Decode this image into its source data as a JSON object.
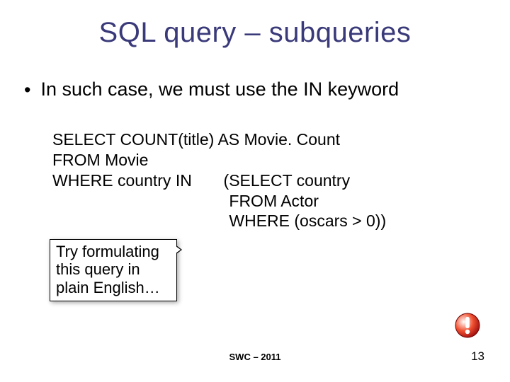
{
  "title": "SQL query – subqueries",
  "bullet": "In such case, we must use the IN keyword",
  "code": {
    "l1": "SELECT COUNT(title) AS Movie. Count",
    "l2": "FROM Movie",
    "l3": "WHERE country IN       (SELECT country",
    "l4": " FROM Actor",
    "l5": " WHERE (oscars > 0))"
  },
  "callout": {
    "line1": "Try formulating",
    "line2": "this query in",
    "line3": "plain English…"
  },
  "footer": "SWC – 2011",
  "page": "13"
}
